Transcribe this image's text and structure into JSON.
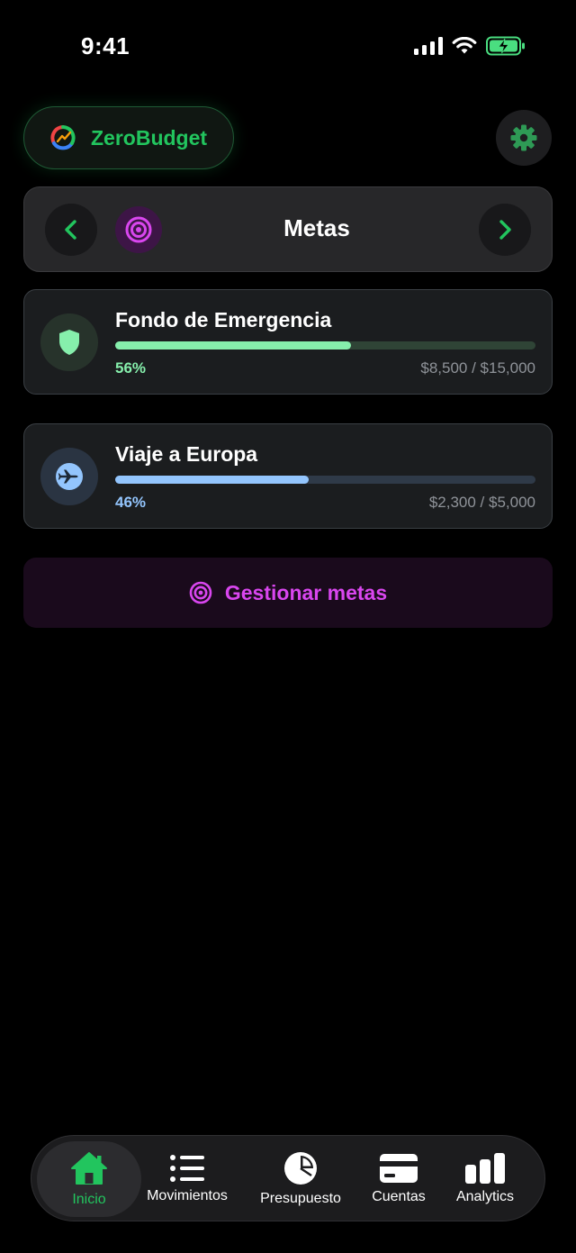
{
  "status_bar": {
    "time": "9:41"
  },
  "header": {
    "brand": "ZeroBudget"
  },
  "switcher": {
    "title": "Metas"
  },
  "goals": [
    {
      "title": "Fondo de Emergencia",
      "percent": "56%",
      "progress": 0.56,
      "amount": "$8,500 / $15,000",
      "color": "#86efac",
      "icon": "shield-icon"
    },
    {
      "title": "Viaje a Europa",
      "percent": "46%",
      "progress": 0.46,
      "amount": "$2,300 / $5,000",
      "color": "#93c5fd",
      "icon": "airplane-icon"
    }
  ],
  "manage": {
    "label": "Gestionar metas"
  },
  "tabs": [
    {
      "label": "Inicio",
      "icon": "home-icon",
      "active": true
    },
    {
      "label": "Movimientos",
      "icon": "list-icon",
      "active": false
    },
    {
      "label": "Presupuesto",
      "icon": "pie-chart-icon",
      "active": false
    },
    {
      "label": "Cuentas",
      "icon": "credit-card-icon",
      "active": false
    },
    {
      "label": "Analytics",
      "icon": "bar-chart-icon",
      "active": false
    }
  ],
  "colors": {
    "accent_green": "#22c55e",
    "accent_magenta": "#d946ef",
    "background": "#000000"
  }
}
